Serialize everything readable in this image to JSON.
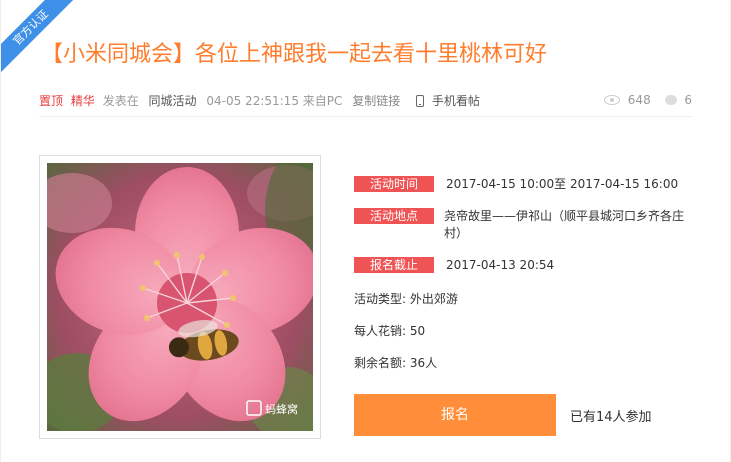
{
  "badge": {
    "label": "官方认证"
  },
  "post": {
    "title": "【小米同城会】各位上神跟我一起去看十里桃林可好"
  },
  "meta": {
    "tag_top": "置顶",
    "tag_essence": "精华",
    "posted_in": "发表在",
    "forum": "同城活动",
    "datetime": "04-05 22:51:15",
    "source": "来自PC",
    "copy_link": "复制链接",
    "mobile_view": "手机看帖",
    "views": "648",
    "comments": "6"
  },
  "activity": {
    "time_label": "活动时间",
    "time_value": "2017-04-15 10:00至 2017-04-15 16:00",
    "place_label": "活动地点",
    "place_value": "尧帝故里——伊祁山（顺平县城河口乡齐各庄村）",
    "deadline_label": "报名截止",
    "deadline_value": "2017-04-13 20:54",
    "type": "活动类型: 外出郊游",
    "cost": "每人花销: 50",
    "remaining": "剩余名额: 36人"
  },
  "actions": {
    "signup_label": "报名",
    "joined_text": "已有14人参加"
  },
  "image": {
    "watermark": "蚂蜂窝"
  },
  "colors": {
    "accent_orange": "#ff7d2e",
    "button_orange": "#ff8d3a",
    "tag_red": "#f05353",
    "badge_blue": "#3d8fe8"
  }
}
